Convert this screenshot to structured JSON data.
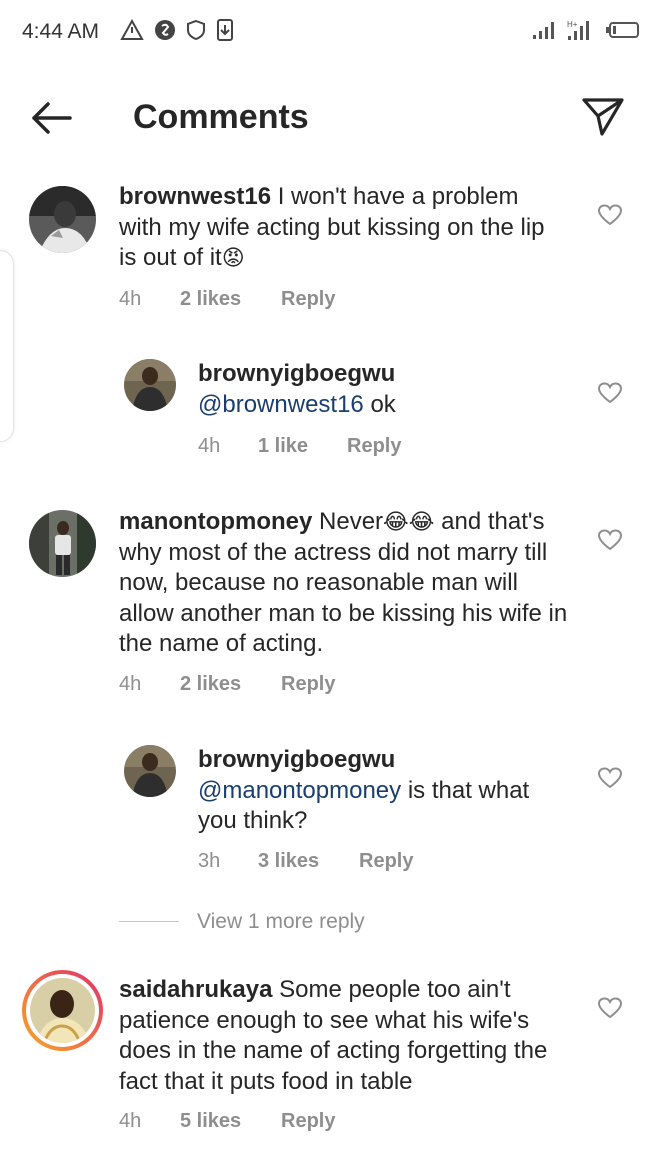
{
  "status_bar": {
    "time": "4:44 AM",
    "left_icons": [
      "warning-triangle-icon",
      "shazam-icon",
      "shield-icon",
      "download-icon"
    ],
    "right_icons": [
      "signal-icon",
      "signal-icon",
      "battery-icon"
    ]
  },
  "header": {
    "title": "Comments",
    "back_icon": "arrow-left-icon",
    "share_icon": "paper-plane-icon"
  },
  "comments": [
    {
      "username": "brownwest16",
      "text_before_emoji": " I won't have a problem with my wife acting but kissing on the lip is out of it",
      "emoji": "😡",
      "time": "4h",
      "likes": "2 likes",
      "reply": "Reply",
      "replies": [
        {
          "username": "brownyigboegwu",
          "mention": "@brownwest16",
          "text": " ok",
          "time": "4h",
          "likes": "1 like",
          "reply": "Reply"
        }
      ]
    },
    {
      "username": "manontopmoney",
      "text_before_emoji": " Never",
      "emoji": "😂😂",
      "text_after_emoji": " and that's why most of the actress did not marry till now, because no reasonable man will allow another man to be kissing his wife in the name of acting.",
      "time": "4h",
      "likes": "2 likes",
      "reply": "Reply",
      "replies": [
        {
          "username": "brownyigboegwu",
          "mention": "@manontopmoney",
          "text": " is that what you think?",
          "time": "3h",
          "likes": "3 likes",
          "reply": "Reply"
        }
      ],
      "view_more": "View 1 more reply"
    },
    {
      "username": "saidahrukaya",
      "text_before_emoji": " Some people too ain't patience enough to see what his wife's does in the name of acting forgetting the fact that it puts food in table",
      "time": "4h",
      "likes": "5 likes",
      "reply": "Reply"
    }
  ]
}
